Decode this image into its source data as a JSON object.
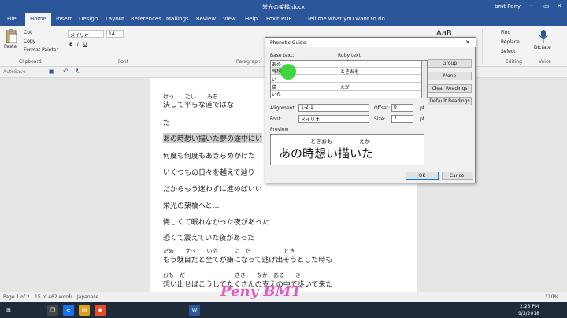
{
  "window": {
    "title": "栄光の架橋.docx",
    "user": "bmt Peny",
    "controls": [
      "─",
      "▭",
      "✕"
    ]
  },
  "tabs": [
    "File",
    "Home",
    "Insert",
    "Design",
    "Layout",
    "References",
    "Mailings",
    "Review",
    "View",
    "Help",
    "Foxit PDF",
    "Tell me what you want to do"
  ],
  "ribbon": {
    "paste": "Paste",
    "cut": "Cut",
    "copy": "Copy",
    "format_painter": "Format Painter",
    "clipboard": "Clipboard",
    "font_name": "メイリオ",
    "font_size": "14",
    "font": "Font",
    "paragraph": "Paragraph",
    "find": "Find",
    "replace": "Replace",
    "select": "Select",
    "editing": "Editing",
    "dictate": "Dictate",
    "voice": "Voice",
    "style_label": "AaB"
  },
  "qat": {
    "autosave": "AutoSave"
  },
  "doc": {
    "ruby1": "けっ　　たい　　みち",
    "line1": "決して平らな道ではな",
    "line2": "だ",
    "line3": "あの時想い描いた夢の途中にい",
    "line4": "何度も何度もあきらめかけた",
    "line5": "いくつもの日々を越えて辿り",
    "line6": "だからもう迷わずに進めばいい",
    "line7": "栄光の架橋へと…",
    "line8": "悔しくて眠れなかった夜があった",
    "line9": "恐くて震えていた夜があった",
    "ruby10": "だめ　　すべ　　いや　　　に　だ　　　　　　とき",
    "line10": "もう駄目だと全てが嫌になって逃げ出そうとした時も",
    "ruby11": "おも　だ　　　　　　　　　ささ　　なか　ある　　き",
    "line11": "想い出せばこうしてたくさんの支えの中で歩いて来た"
  },
  "dialog": {
    "title": "Phonetic Guide",
    "base_text_label": "Base text:",
    "ruby_text_label": "Ruby text:",
    "rows": [
      {
        "base": "あの",
        "ruby": ""
      },
      {
        "base": "時想",
        "ruby": "ときおも"
      },
      {
        "base": "い",
        "ruby": ""
      },
      {
        "base": "描",
        "ruby": "えが"
      },
      {
        "base": "いた",
        "ruby": ""
      }
    ],
    "buttons": {
      "group": "Group",
      "mono": "Mono",
      "clear": "Clear Readings",
      "default": "Default Readings",
      "ok": "OK",
      "cancel": "Cancel"
    },
    "alignment_label": "Alignment:",
    "alignment": "1-2-1",
    "offset_label": "Offset:",
    "offset": "0",
    "offset_unit": "pt",
    "font_label": "Font:",
    "font": "メイリオ",
    "size_label": "Size:",
    "size": "7",
    "size_unit": "pt",
    "preview_label": "Preview",
    "preview_text": "あの時想い描いた",
    "preview_ruby1": "ときおも",
    "preview_ruby2": "えが"
  },
  "status": {
    "page": "Page 1 of 2",
    "words": "15 of 462 words",
    "lang": "Japanese",
    "zoom": "110%"
  },
  "taskbar": {
    "time": "2:23 PM",
    "date": "9/3/2018"
  },
  "watermark": "Peny BMT"
}
